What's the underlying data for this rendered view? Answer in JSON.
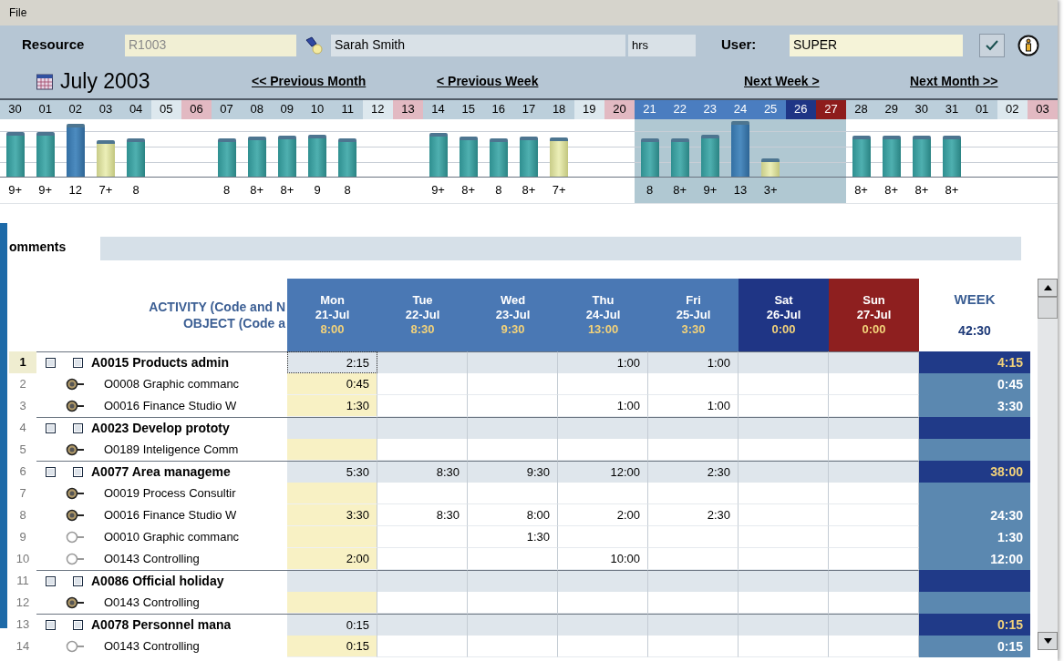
{
  "menu": [
    "File"
  ],
  "resource": {
    "label": "Resource",
    "code": "R1003",
    "name": "Sarah Smith",
    "unit": "hrs"
  },
  "user": {
    "label": "User:",
    "value": "SUPER"
  },
  "period": {
    "title": "July 2003"
  },
  "nav": [
    "<< Previous Month",
    "< Previous Week",
    "Next Week >",
    "Next Month >>"
  ],
  "days": [
    {
      "day": "30",
      "kind": "weekday",
      "selected": false,
      "bar": {
        "label": "9+",
        "level": 0.76,
        "kind": "normal"
      }
    },
    {
      "day": "01",
      "kind": "weekday",
      "selected": false,
      "bar": {
        "label": "9+",
        "level": 0.76,
        "kind": "normal"
      }
    },
    {
      "day": "02",
      "kind": "weekday",
      "selected": false,
      "bar": {
        "label": "12",
        "level": 0.9,
        "kind": "high"
      }
    },
    {
      "day": "03",
      "kind": "weekday",
      "selected": false,
      "bar": {
        "label": "7+",
        "level": 0.62,
        "kind": "partial"
      }
    },
    {
      "day": "04",
      "kind": "weekday",
      "selected": false,
      "bar": {
        "label": "8",
        "level": 0.65,
        "kind": "normal"
      }
    },
    {
      "day": "05",
      "kind": "saturday",
      "selected": false
    },
    {
      "day": "06",
      "kind": "sunday",
      "selected": false
    },
    {
      "day": "07",
      "kind": "weekday",
      "selected": false,
      "bar": {
        "label": "8",
        "level": 0.65,
        "kind": "normal"
      }
    },
    {
      "day": "08",
      "kind": "weekday",
      "selected": false,
      "bar": {
        "label": "8+",
        "level": 0.68,
        "kind": "normal"
      }
    },
    {
      "day": "09",
      "kind": "weekday",
      "selected": false,
      "bar": {
        "label": "8+",
        "level": 0.7,
        "kind": "normal"
      }
    },
    {
      "day": "10",
      "kind": "weekday",
      "selected": false,
      "bar": {
        "label": "9",
        "level": 0.72,
        "kind": "normal"
      }
    },
    {
      "day": "11",
      "kind": "weekday",
      "selected": false,
      "bar": {
        "label": "8",
        "level": 0.65,
        "kind": "normal"
      }
    },
    {
      "day": "12",
      "kind": "saturday",
      "selected": false
    },
    {
      "day": "13",
      "kind": "sunday",
      "selected": false
    },
    {
      "day": "14",
      "kind": "weekday",
      "selected": false,
      "bar": {
        "label": "9+",
        "level": 0.74,
        "kind": "normal"
      }
    },
    {
      "day": "15",
      "kind": "weekday",
      "selected": false,
      "bar": {
        "label": "8+",
        "level": 0.68,
        "kind": "normal"
      }
    },
    {
      "day": "16",
      "kind": "weekday",
      "selected": false,
      "bar": {
        "label": "8",
        "level": 0.65,
        "kind": "normal"
      }
    },
    {
      "day": "17",
      "kind": "weekday",
      "selected": false,
      "bar": {
        "label": "8+",
        "level": 0.68,
        "kind": "normal"
      }
    },
    {
      "day": "18",
      "kind": "weekday",
      "selected": false,
      "bar": {
        "label": "7+",
        "level": 0.66,
        "kind": "partial"
      }
    },
    {
      "day": "19",
      "kind": "saturday",
      "selected": false
    },
    {
      "day": "20",
      "kind": "sunday",
      "selected": false
    },
    {
      "day": "21",
      "kind": "weekday",
      "selected": true,
      "bar": {
        "label": "8",
        "level": 0.65,
        "kind": "normal"
      }
    },
    {
      "day": "22",
      "kind": "weekday",
      "selected": true,
      "bar": {
        "label": "8+",
        "level": 0.65,
        "kind": "normal"
      }
    },
    {
      "day": "23",
      "kind": "weekday",
      "selected": true,
      "bar": {
        "label": "9+",
        "level": 0.72,
        "kind": "normal"
      }
    },
    {
      "day": "24",
      "kind": "weekday",
      "selected": true,
      "bar": {
        "label": "13",
        "level": 0.95,
        "kind": "high"
      }
    },
    {
      "day": "25",
      "kind": "weekday",
      "selected": true,
      "bar": {
        "label": "3+",
        "level": 0.3,
        "kind": "partial"
      }
    },
    {
      "day": "26",
      "kind": "saturday",
      "selected": true
    },
    {
      "day": "27",
      "kind": "sunday",
      "selected": true
    },
    {
      "day": "28",
      "kind": "weekday",
      "selected": false,
      "bar": {
        "label": "8+",
        "level": 0.7,
        "kind": "normal"
      }
    },
    {
      "day": "29",
      "kind": "weekday",
      "selected": false,
      "bar": {
        "label": "8+",
        "level": 0.7,
        "kind": "normal"
      }
    },
    {
      "day": "30",
      "kind": "weekday",
      "selected": false,
      "bar": {
        "label": "8+",
        "level": 0.7,
        "kind": "normal"
      }
    },
    {
      "day": "31",
      "kind": "weekday",
      "selected": false,
      "bar": {
        "label": "8+",
        "level": 0.7,
        "kind": "normal"
      }
    },
    {
      "day": "01",
      "kind": "weekday",
      "selected": false
    },
    {
      "day": "02",
      "kind": "saturday",
      "selected": false
    },
    {
      "day": "03",
      "kind": "sunday",
      "selected": false
    }
  ],
  "comments": {
    "label": "omments"
  },
  "grid": {
    "activity_header": [
      "ACTIVITY (Code and N",
      "OBJECT (Code a"
    ],
    "columns": [
      {
        "day": "Mon",
        "date": "21-Jul",
        "total": "8:00",
        "kind": "weekday"
      },
      {
        "day": "Tue",
        "date": "22-Jul",
        "total": "8:30",
        "kind": "weekday"
      },
      {
        "day": "Wed",
        "date": "23-Jul",
        "total": "9:30",
        "kind": "weekday"
      },
      {
        "day": "Thu",
        "date": "24-Jul",
        "total": "13:00",
        "kind": "weekday"
      },
      {
        "day": "Fri",
        "date": "25-Jul",
        "total": "3:30",
        "kind": "weekday"
      },
      {
        "day": "Sat",
        "date": "26-Jul",
        "total": "0:00",
        "kind": "saturday"
      },
      {
        "day": "Sun",
        "date": "27-Jul",
        "total": "0:00",
        "kind": "sunday"
      }
    ],
    "week": {
      "label": "WEEK",
      "total": "42:30"
    },
    "rows": [
      {
        "num": "1",
        "kind": "activity",
        "checked": false,
        "included": false,
        "selected": true,
        "name": "A0015 Products admin",
        "cells": [
          "2:15",
          null,
          null,
          "1:00",
          "1:00",
          null,
          null
        ],
        "week": "4:15"
      },
      {
        "num": "2",
        "kind": "object",
        "active": true,
        "selected": false,
        "name": "O0008 Graphic commanc",
        "cells": [
          "0:45",
          null,
          null,
          null,
          null,
          null,
          null
        ],
        "week": "0:45"
      },
      {
        "num": "3",
        "kind": "object",
        "active": true,
        "selected": false,
        "name": "O0016 Finance Studio W",
        "cells": [
          "1:30",
          null,
          null,
          "1:00",
          "1:00",
          null,
          null
        ],
        "week": "3:30"
      },
      {
        "num": "4",
        "kind": "activity",
        "checked": false,
        "included": false,
        "selected": false,
        "name": "A0023 Develop prototy",
        "cells": [
          null,
          null,
          null,
          null,
          null,
          null,
          null
        ]
      },
      {
        "num": "5",
        "kind": "object",
        "active": true,
        "selected": false,
        "name": "O0189 Inteligence Comm",
        "cells": [
          null,
          null,
          null,
          null,
          null,
          null,
          null
        ]
      },
      {
        "num": "6",
        "kind": "activity",
        "checked": false,
        "included": false,
        "selected": false,
        "name": "A0077 Area manageme",
        "cells": [
          "5:30",
          "8:30",
          "9:30",
          "12:00",
          "2:30",
          null,
          null
        ],
        "week": "38:00"
      },
      {
        "num": "7",
        "kind": "object",
        "active": true,
        "selected": false,
        "name": "O0019 Process Consultir",
        "cells": [
          null,
          null,
          null,
          null,
          null,
          null,
          null
        ]
      },
      {
        "num": "8",
        "kind": "object",
        "active": true,
        "selected": false,
        "name": "O0016 Finance Studio W",
        "cells": [
          "3:30",
          "8:30",
          "8:00",
          "2:00",
          "2:30",
          null,
          null
        ],
        "week": "24:30"
      },
      {
        "num": "9",
        "kind": "object",
        "active": false,
        "selected": false,
        "name": "O0010 Graphic commanc",
        "cells": [
          null,
          null,
          "1:30",
          null,
          null,
          null,
          null
        ],
        "week": "1:30"
      },
      {
        "num": "10",
        "kind": "object",
        "active": false,
        "selected": false,
        "name": "O0143 Controlling",
        "cells": [
          "2:00",
          null,
          null,
          "10:00",
          null,
          null,
          null
        ],
        "week": "12:00"
      },
      {
        "num": "11",
        "kind": "activity",
        "checked": false,
        "included": false,
        "selected": false,
        "name": "A0086 Official holiday",
        "cells": [
          null,
          null,
          null,
          null,
          null,
          null,
          null
        ]
      },
      {
        "num": "12",
        "kind": "object",
        "active": true,
        "selected": false,
        "name": "O0143 Controlling",
        "cells": [
          null,
          null,
          null,
          null,
          null,
          null,
          null
        ]
      },
      {
        "num": "13",
        "kind": "activity",
        "checked": false,
        "included": false,
        "selected": false,
        "name": "A0078 Personnel mana",
        "cells": [
          "0:15",
          null,
          null,
          null,
          null,
          null,
          null
        ],
        "week": "0:15"
      },
      {
        "num": "14",
        "kind": "object",
        "active": false,
        "selected": false,
        "name": "O0143 Controlling",
        "cells": [
          "0:15",
          null,
          null,
          null,
          null,
          null,
          null
        ],
        "week": "0:15"
      }
    ]
  }
}
